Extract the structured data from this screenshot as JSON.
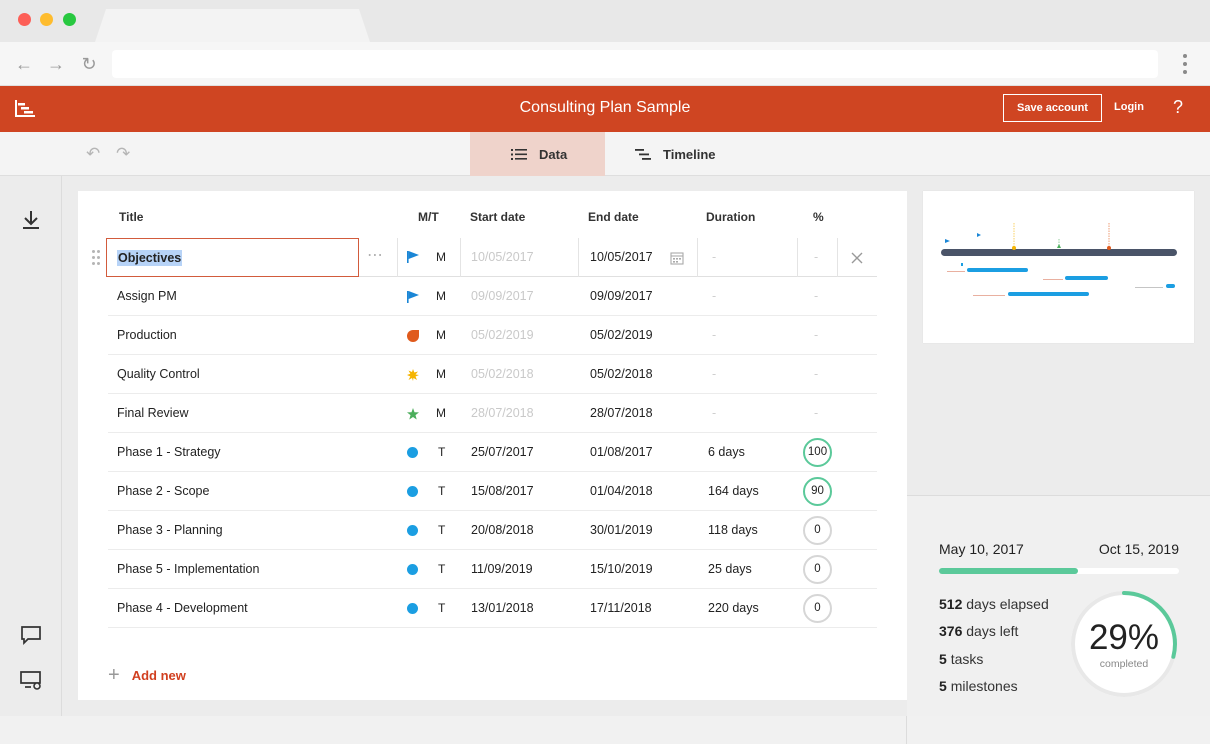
{
  "app": {
    "title": "Consulting Plan Sample",
    "save_label": "Save account",
    "login_label": "Login",
    "help_label": "?"
  },
  "tabs": [
    {
      "label": "Data",
      "active": true
    },
    {
      "label": "Timeline",
      "active": false
    }
  ],
  "table": {
    "headers": {
      "title": "Title",
      "mt": "M/T",
      "start": "Start date",
      "end": "End date",
      "duration": "Duration",
      "pct": "%"
    },
    "editing": {
      "title": "Objectives",
      "type": "M",
      "start": "10/05/2017",
      "end": "10/05/2017",
      "duration": "-",
      "pct": "-",
      "icon": "flag-icon",
      "color": "#1a86d6"
    },
    "rows": [
      {
        "title": "Assign PM",
        "type": "M",
        "start": "09/09/2017",
        "end": "09/09/2017",
        "duration": "-",
        "pct": "-",
        "icon": "flag-icon",
        "color": "#1a86d6"
      },
      {
        "title": "Production",
        "type": "M",
        "start": "05/02/2019",
        "end": "05/02/2019",
        "duration": "-",
        "pct": "-",
        "icon": "leaf-icon",
        "color": "#e05a1c"
      },
      {
        "title": "Quality Control",
        "type": "M",
        "start": "05/02/2018",
        "end": "05/02/2018",
        "duration": "-",
        "pct": "-",
        "icon": "sun-icon",
        "color": "#f5b400"
      },
      {
        "title": "Final Review",
        "type": "M",
        "start": "28/07/2018",
        "end": "28/07/2018",
        "duration": "-",
        "pct": "-",
        "icon": "star-icon",
        "color": "#4cae5c"
      },
      {
        "title": "Phase 1 - Strategy",
        "type": "T",
        "start": "25/07/2017",
        "end": "01/08/2017",
        "duration": "6 days",
        "pct": "100",
        "pct_value": 100,
        "icon": "dot-icon",
        "color": "#1b9ee2"
      },
      {
        "title": "Phase 2 - Scope",
        "type": "T",
        "start": "15/08/2017",
        "end": "01/04/2018",
        "duration": "164 days",
        "pct": "90",
        "pct_value": 90,
        "icon": "dot-icon",
        "color": "#1b9ee2"
      },
      {
        "title": "Phase 3 - Planning",
        "type": "T",
        "start": "20/08/2018",
        "end": "30/01/2019",
        "duration": "118 days",
        "pct": "0",
        "pct_value": 0,
        "icon": "dot-icon",
        "color": "#1b9ee2"
      },
      {
        "title": "Phase 5 - Implementation",
        "type": "T",
        "start": "11/09/2019",
        "end": "15/10/2019",
        "duration": "25 days",
        "pct": "0",
        "pct_value": 0,
        "icon": "dot-icon",
        "color": "#1b9ee2"
      },
      {
        "title": "Phase 4 - Development",
        "type": "T",
        "start": "13/01/2018",
        "end": "17/11/2018",
        "duration": "220 days",
        "pct": "0",
        "pct_value": 0,
        "icon": "dot-icon",
        "color": "#1b9ee2"
      }
    ],
    "add_new_label": "Add new"
  },
  "stats": {
    "start_date": "May 10, 2017",
    "end_date": "Oct 15, 2019",
    "progress": 0.58,
    "days_elapsed": "512",
    "days_elapsed_label": "days elapsed",
    "days_left": "376",
    "days_left_label": "days left",
    "tasks": "5",
    "tasks_label": "tasks",
    "milestones": "5",
    "milestones_label": "milestones",
    "percent_completed": "29%",
    "percent_value": 29,
    "completed_label": "completed"
  },
  "colors": {
    "brand": "#cf4522",
    "accent_green": "#5bc99a",
    "task_blue": "#1b9ee2",
    "timeline_bar": "#4a5468"
  }
}
